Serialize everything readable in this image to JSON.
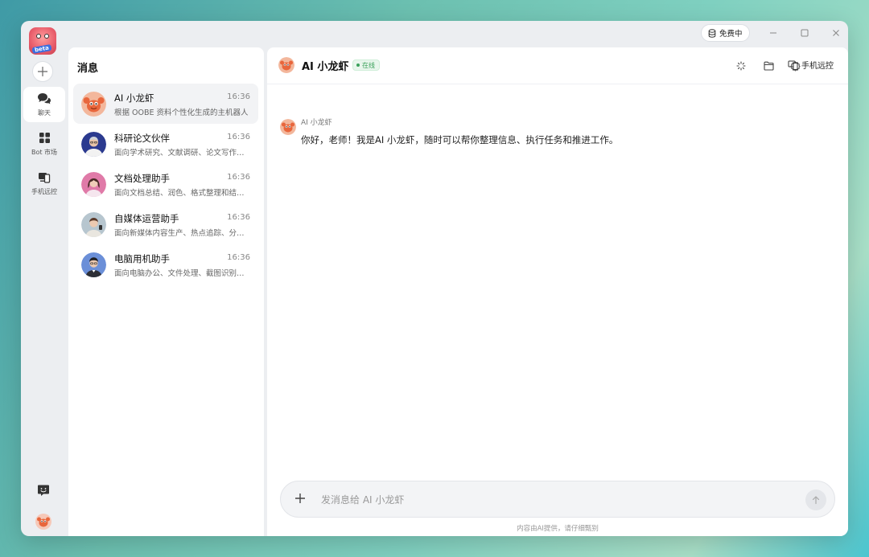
{
  "window": {
    "free_badge": "免费中"
  },
  "rail": {
    "items": [
      {
        "label": "聊天"
      },
      {
        "label": "Bot 市场"
      },
      {
        "label": "手机远控"
      }
    ]
  },
  "list": {
    "title": "消息",
    "conversations": [
      {
        "name": "AI 小龙虾",
        "time": "16:36",
        "desc": "根据 OOBE 资料个性化生成的主机器人"
      },
      {
        "name": "科研论文伙伴",
        "time": "16:36",
        "desc": "面向学术研究、文献调研、论文写作和学术规范"
      },
      {
        "name": "文档处理助手",
        "time": "16:36",
        "desc": "面向文档总结、润色、格式整理和结构优化"
      },
      {
        "name": "自媒体运营助手",
        "time": "16:36",
        "desc": "面向新媒体内容生产、热点追踪、分发运营"
      },
      {
        "name": "电脑用机助手",
        "time": "16:36",
        "desc": "面向电脑办公、文件处理、截图识别和操作"
      }
    ]
  },
  "chat": {
    "title": "AI 小龙虾",
    "status": "在线",
    "remote_label": "手机远控",
    "messages": [
      {
        "sender": "AI 小龙虾",
        "text": "你好，老师！我是AI 小龙虾，随时可以帮你整理信息、执行任务和推进工作。"
      }
    ],
    "composer_placeholder": "发消息给 AI 小龙虾",
    "disclaimer": "内容由AI提供，请仔细甄别"
  },
  "colors": {
    "status_green": "#3aa15a",
    "crayfish_orange": "#e8663c"
  }
}
